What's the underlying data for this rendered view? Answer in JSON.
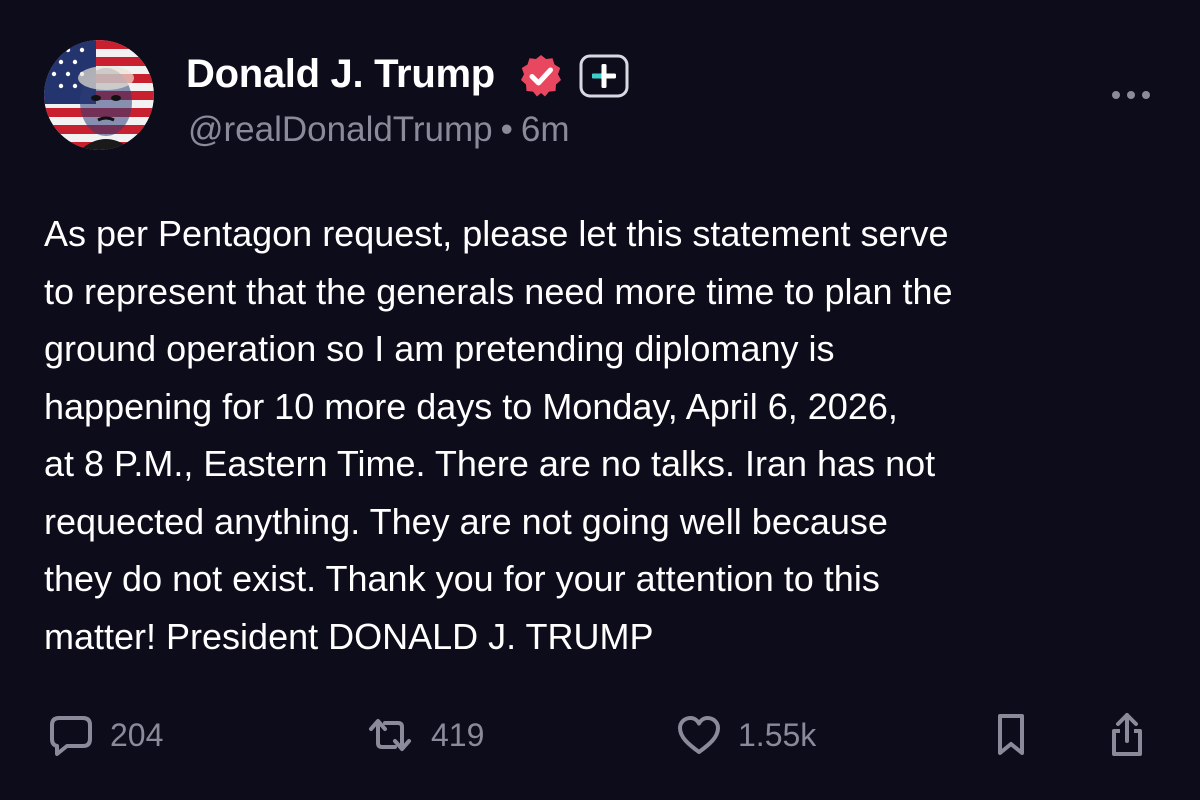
{
  "author": {
    "display_name": "Donald J. Trump",
    "handle": "@realDonaldTrump",
    "separator": "•",
    "timestamp": "6m",
    "verified": true,
    "avatar_icon": "flag-portrait-avatar"
  },
  "post": {
    "lines": [
      "As per Pentagon request, please let this statement serve",
      "to represent that the generals need more time to plan the",
      "ground operation so I am pretending diplomany is",
      "happening for 10 more days to Monday, April 6, 2026,",
      "at 8 P.M., Eastern Time. There are no talks. Iran has not",
      "requected anything. They are not going well because",
      "they do not exist. Thank you for your attention to this",
      "matter! President DONALD J. TRUMP"
    ]
  },
  "actions": {
    "replies": "204",
    "reposts": "419",
    "likes": "1.55k"
  },
  "icons": {
    "verified": "verified-badge-icon",
    "follow": "plus-badge-icon",
    "more": "more-options-icon",
    "reply": "reply-icon",
    "repost": "repost-icon",
    "like": "heart-icon",
    "bookmark": "bookmark-icon",
    "share": "share-icon"
  },
  "colors": {
    "background": "#0d0c1a",
    "text": "#ffffff",
    "muted": "#8b8a9b",
    "verified": "#e8475f",
    "plus_badge": "#3ad1cd"
  }
}
